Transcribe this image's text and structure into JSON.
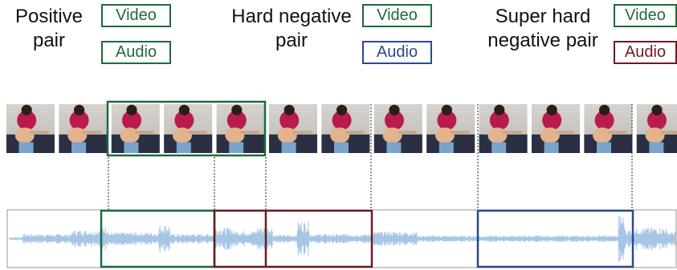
{
  "legend": {
    "positive": {
      "line1": "Positive",
      "line2": "pair",
      "video": "Video",
      "audio": "Audio"
    },
    "hard": {
      "line1": "Hard negative",
      "line2": "pair",
      "video": "Video",
      "audio": "Audio"
    },
    "super": {
      "line1": "Super hard",
      "line2": "negative pair",
      "video": "Video",
      "audio": "Audio"
    }
  },
  "colors": {
    "positive": "#1c6b3c",
    "hard": "#2a4a8e",
    "super": "#6b1d22",
    "waveform": "#a7c6e6"
  },
  "frames": {
    "count": 13
  }
}
